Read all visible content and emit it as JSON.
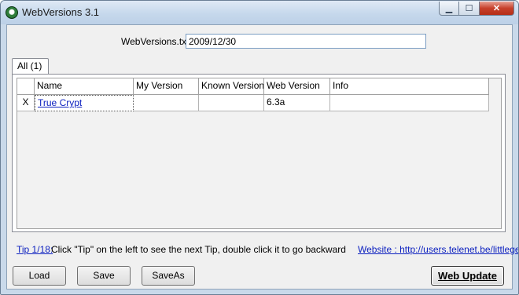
{
  "window": {
    "title": "WebVersions 3.1",
    "controls": {
      "minimize": "▁",
      "maximize": "☐",
      "close": "✕"
    }
  },
  "file": {
    "label": "WebVersions.txt:",
    "value": "2009/12/30"
  },
  "tabs": [
    {
      "label": "All (1)"
    }
  ],
  "grid": {
    "columns": [
      "",
      "Name",
      "My Version",
      "Known Version",
      "Web Version",
      "Info"
    ],
    "rows": [
      {
        "mark": "X",
        "name": "True Crypt",
        "my_version": "",
        "known_version": "",
        "web_version": "6.3a",
        "info": ""
      }
    ]
  },
  "tip": {
    "link": "Tip 1/18:",
    "text": "Click \"Tip\" on the left to see the next Tip, double click it to go backward"
  },
  "website": "Website : http://users.telenet.be/littlegems",
  "buttons": {
    "load": "Load",
    "save": "Save",
    "saveas": "SaveAs",
    "web_update": "Web Update"
  },
  "colors": {
    "link": "#0b1fbf",
    "titlebar": "#c6d8ec",
    "close": "#c7402b"
  }
}
